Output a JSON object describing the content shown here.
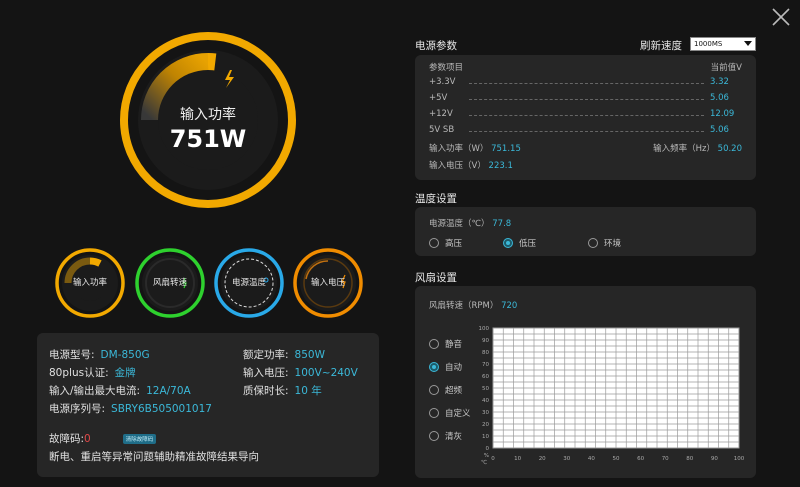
{
  "big_gauge": {
    "label": "输入功率",
    "value": "751W",
    "color": "#f2a900"
  },
  "small_gauges": [
    {
      "label": "输入功率",
      "color": "#f2a900"
    },
    {
      "label": "风扇转速",
      "color": "#2ed12e"
    },
    {
      "label": "电源温度",
      "color": "#29a9e8"
    },
    {
      "label": "输入电压",
      "color": "#f08c00"
    }
  ],
  "device_info": {
    "model_label": "电源型号:",
    "model_value": "DM-850G",
    "rated_power_label": "额定功率:",
    "rated_power_value": "850W",
    "cert_label": "80plus认证:",
    "cert_value": "金牌",
    "input_voltage_label": "输入电压:",
    "input_voltage_value": "100V~240V",
    "max_current_label": "输入/输出最大电流:",
    "max_current_value": "12A/70A",
    "warranty_label": "质保时长:",
    "warranty_value": "10 年",
    "serial_label": "电源序列号:",
    "serial_value": "SBRY6B505001017",
    "fault_label": "故障码:",
    "fault_code": "0",
    "fault_badge": "清除故障码",
    "fault_hint": "断电、重启等异常问题辅助精准故障结果导向"
  },
  "power_params": {
    "title": "电源参数",
    "refresh_label": "刷新速度",
    "refresh_value": "1000MS",
    "header_name": "参数项目",
    "header_value": "当前值V",
    "rows": [
      {
        "name": "+3.3V",
        "value": "3.32"
      },
      {
        "name": "+5V",
        "value": "5.06"
      },
      {
        "name": "+12V",
        "value": "12.09"
      },
      {
        "name": "5V SB",
        "value": "5.06"
      }
    ],
    "input_power_label": "输入功率（W）",
    "input_power_value": "751.15",
    "input_freq_label": "输入频率（Hz）",
    "input_freq_value": "50.20",
    "input_voltage_label": "输入电压（V）",
    "input_voltage_value": "223.1"
  },
  "temperature": {
    "title": "温度设置",
    "temp_label": "电源温度（℃）",
    "temp_value": "77.8",
    "options": [
      "高压",
      "低压",
      "环境"
    ],
    "selected_index": 1
  },
  "fan": {
    "title": "风扇设置",
    "speed_label": "风扇转速（RPM）",
    "speed_value": "720",
    "modes": [
      "静音",
      "自动",
      "超频",
      "自定义",
      "清灰"
    ],
    "selected_index": 1,
    "chart": {
      "y_ticks": [
        "100",
        "90",
        "80",
        "70",
        "60",
        "50",
        "40",
        "30",
        "20",
        "10",
        "0"
      ],
      "y_unit": "%",
      "x_ticks": [
        "0",
        "10",
        "20",
        "30",
        "40",
        "50",
        "60",
        "70",
        "80",
        "90",
        "100"
      ],
      "x_unit": "℃"
    }
  }
}
